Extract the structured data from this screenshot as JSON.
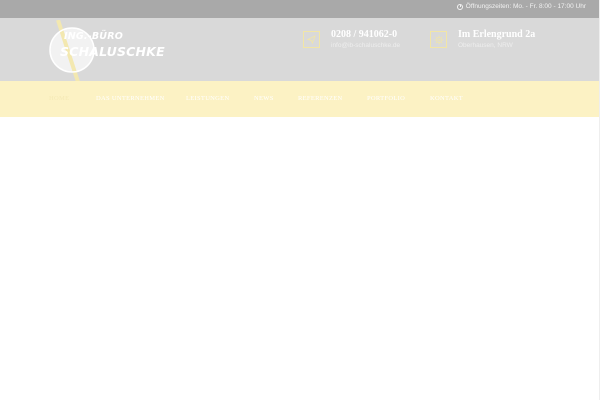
{
  "topbar": {
    "hours": "Öffnungszeiten: Mo. - Fr. 8:00 - 17:00 Uhr",
    "icon": "clock-icon"
  },
  "logo": {
    "line1": "ING.-BÜRO",
    "line2": "SCHALUSCHKE"
  },
  "contact": {
    "phone": "0208 / 941062-0",
    "email": "info@ib-schaluschke.de",
    "icon": "send-icon"
  },
  "address": {
    "street": "Im Erlengrund 2a",
    "city": "Oberhausen, NRW",
    "icon": "gear-icon"
  },
  "nav": {
    "items": [
      {
        "label": "HOME"
      },
      {
        "label": "DAS UNTERNEHMEN"
      },
      {
        "label": "LEISTUNGEN"
      },
      {
        "label": "NEWS"
      },
      {
        "label": "REFERENZEN"
      },
      {
        "label": "PORTFOLIO"
      },
      {
        "label": "KONTAKT"
      }
    ]
  },
  "colors": {
    "topbar": "#a9a9a9",
    "header": "#d9d9d9",
    "nav": "#fcf2c4",
    "accent": "#f2e6a6"
  }
}
